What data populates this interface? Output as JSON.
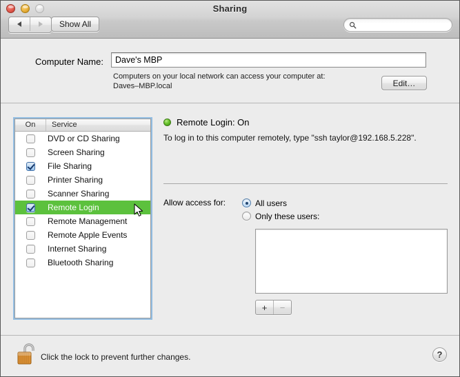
{
  "window": {
    "title": "Sharing"
  },
  "titlebar": {
    "close_label": "",
    "minimize_label": "",
    "zoom_label": "",
    "back_label": "",
    "forward_label": "",
    "show_all_label": "Show All",
    "search_placeholder": "",
    "search_value": ""
  },
  "computer_name": {
    "label": "Computer Name:",
    "value": "Dave's MBP",
    "help_line1": "Computers on your local network can access your computer at:",
    "help_line2": "Daves–MBP.local",
    "edit_label": "Edit…"
  },
  "services": {
    "header": {
      "on": "On",
      "service": "Service"
    },
    "rows": [
      {
        "name": "DVD or CD Sharing",
        "checked": false,
        "selected": false
      },
      {
        "name": "Screen Sharing",
        "checked": false,
        "selected": false
      },
      {
        "name": "File Sharing",
        "checked": true,
        "selected": false
      },
      {
        "name": "Printer Sharing",
        "checked": false,
        "selected": false
      },
      {
        "name": "Scanner Sharing",
        "checked": false,
        "selected": false
      },
      {
        "name": "Remote Login",
        "checked": true,
        "selected": true
      },
      {
        "name": "Remote Management",
        "checked": false,
        "selected": false
      },
      {
        "name": "Remote Apple Events",
        "checked": false,
        "selected": false
      },
      {
        "name": "Internet Sharing",
        "checked": false,
        "selected": false
      },
      {
        "name": "Bluetooth Sharing",
        "checked": false,
        "selected": false
      }
    ]
  },
  "detail": {
    "status_title": "Remote Login: On",
    "status_description": "To log in to this computer remotely, type \"ssh taylor@192.168.5.228\".",
    "access_label": "Allow access for:",
    "radio_all_users": "All users",
    "radio_only_these_users": "Only these users:",
    "selected_radio": "all_users",
    "allowed_users": [],
    "add_user_label": "+",
    "remove_user_label": "−"
  },
  "bottom": {
    "lock_text": "Click the lock to prevent further changes.",
    "lock_state": "unlocked",
    "help_label": "?"
  },
  "colors": {
    "selection_green": "#5cc13d",
    "status_green": "#68c32c",
    "focus_blue": "#74addf",
    "checkbox_blue": "#9cc4ec",
    "window_bg": "#ececec"
  }
}
